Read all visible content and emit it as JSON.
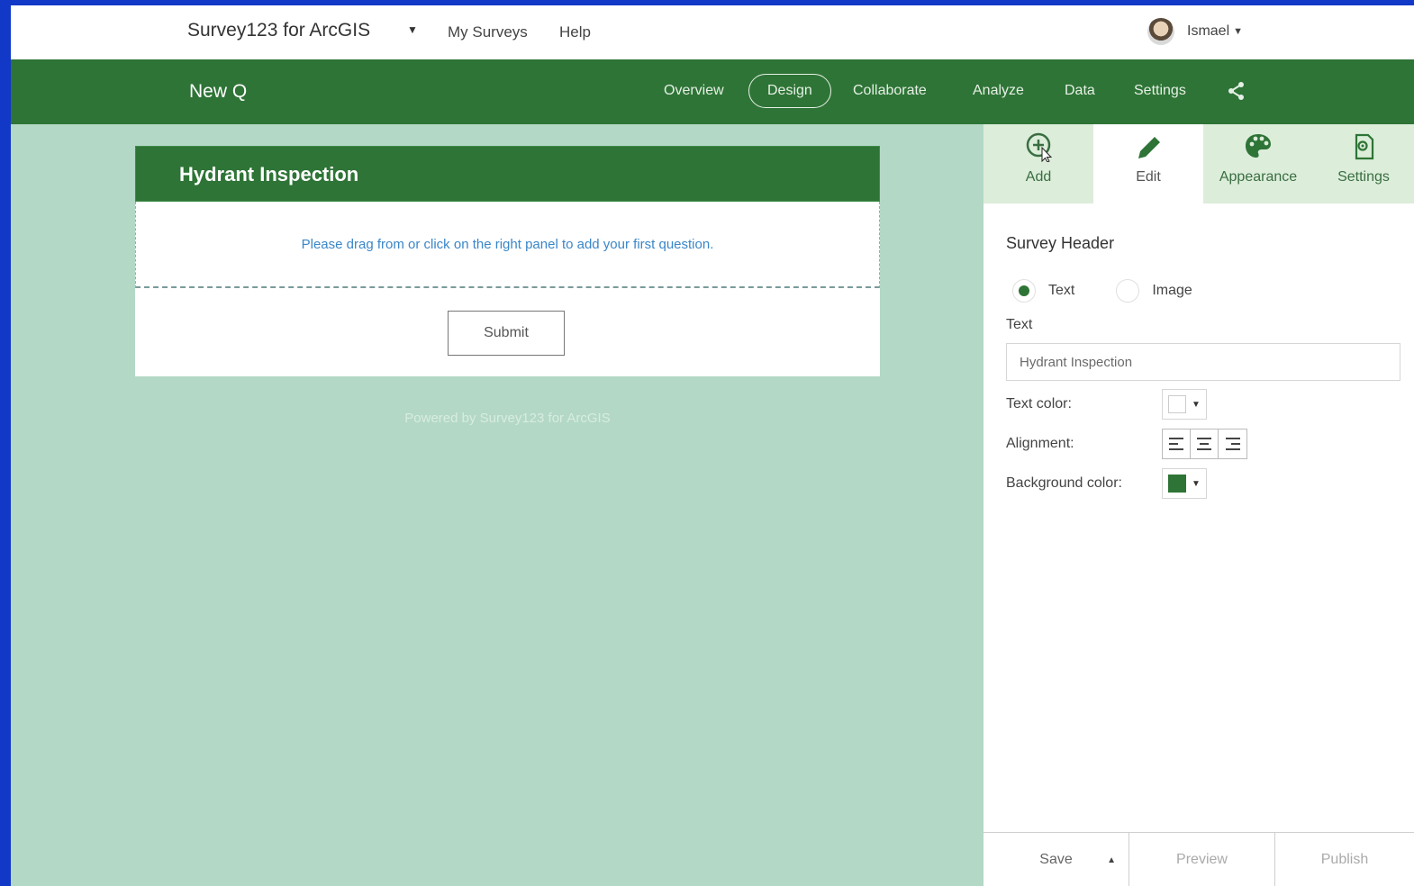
{
  "topbar": {
    "app_title": "Survey123 for ArcGIS",
    "nav": [
      "My Surveys",
      "Help"
    ],
    "user_name": "Ismael"
  },
  "survey_nav": {
    "survey_name": "New Q",
    "tabs": [
      {
        "label": "Overview"
      },
      {
        "label": "Design"
      },
      {
        "label": "Collaborate"
      },
      {
        "label": "Analyze"
      },
      {
        "label": "Data"
      },
      {
        "label": "Settings"
      }
    ],
    "active_tab": "Design"
  },
  "form": {
    "header_title": "Hydrant Inspection",
    "dropzone_hint": "Please drag from or click on the right panel to add your first question.",
    "submit_label": "Submit",
    "powered_by": "Powered by Survey123 for ArcGIS"
  },
  "panel": {
    "tabs": [
      {
        "label": "Add",
        "icon": "add-circle-icon"
      },
      {
        "label": "Edit",
        "icon": "pencil-icon"
      },
      {
        "label": "Appearance",
        "icon": "palette-icon"
      },
      {
        "label": "Settings",
        "icon": "settings-document-icon"
      }
    ],
    "active_tab": "Edit",
    "section_title": "Survey Header",
    "header_type_options": [
      "Text",
      "Image"
    ],
    "header_type_selected": "Text",
    "text_label": "Text",
    "text_value": "Hydrant Inspection",
    "text_color_label": "Text color:",
    "text_color": "#ffffff",
    "alignment_label": "Alignment:",
    "background_color_label": "Background color:",
    "background_color": "#2e7436"
  },
  "footer": {
    "save_label": "Save",
    "preview_label": "Preview",
    "publish_label": "Publish"
  },
  "colors": {
    "brand_green": "#2e7436",
    "canvas": "#b3d8c6",
    "link_blue": "#3a86c8"
  }
}
